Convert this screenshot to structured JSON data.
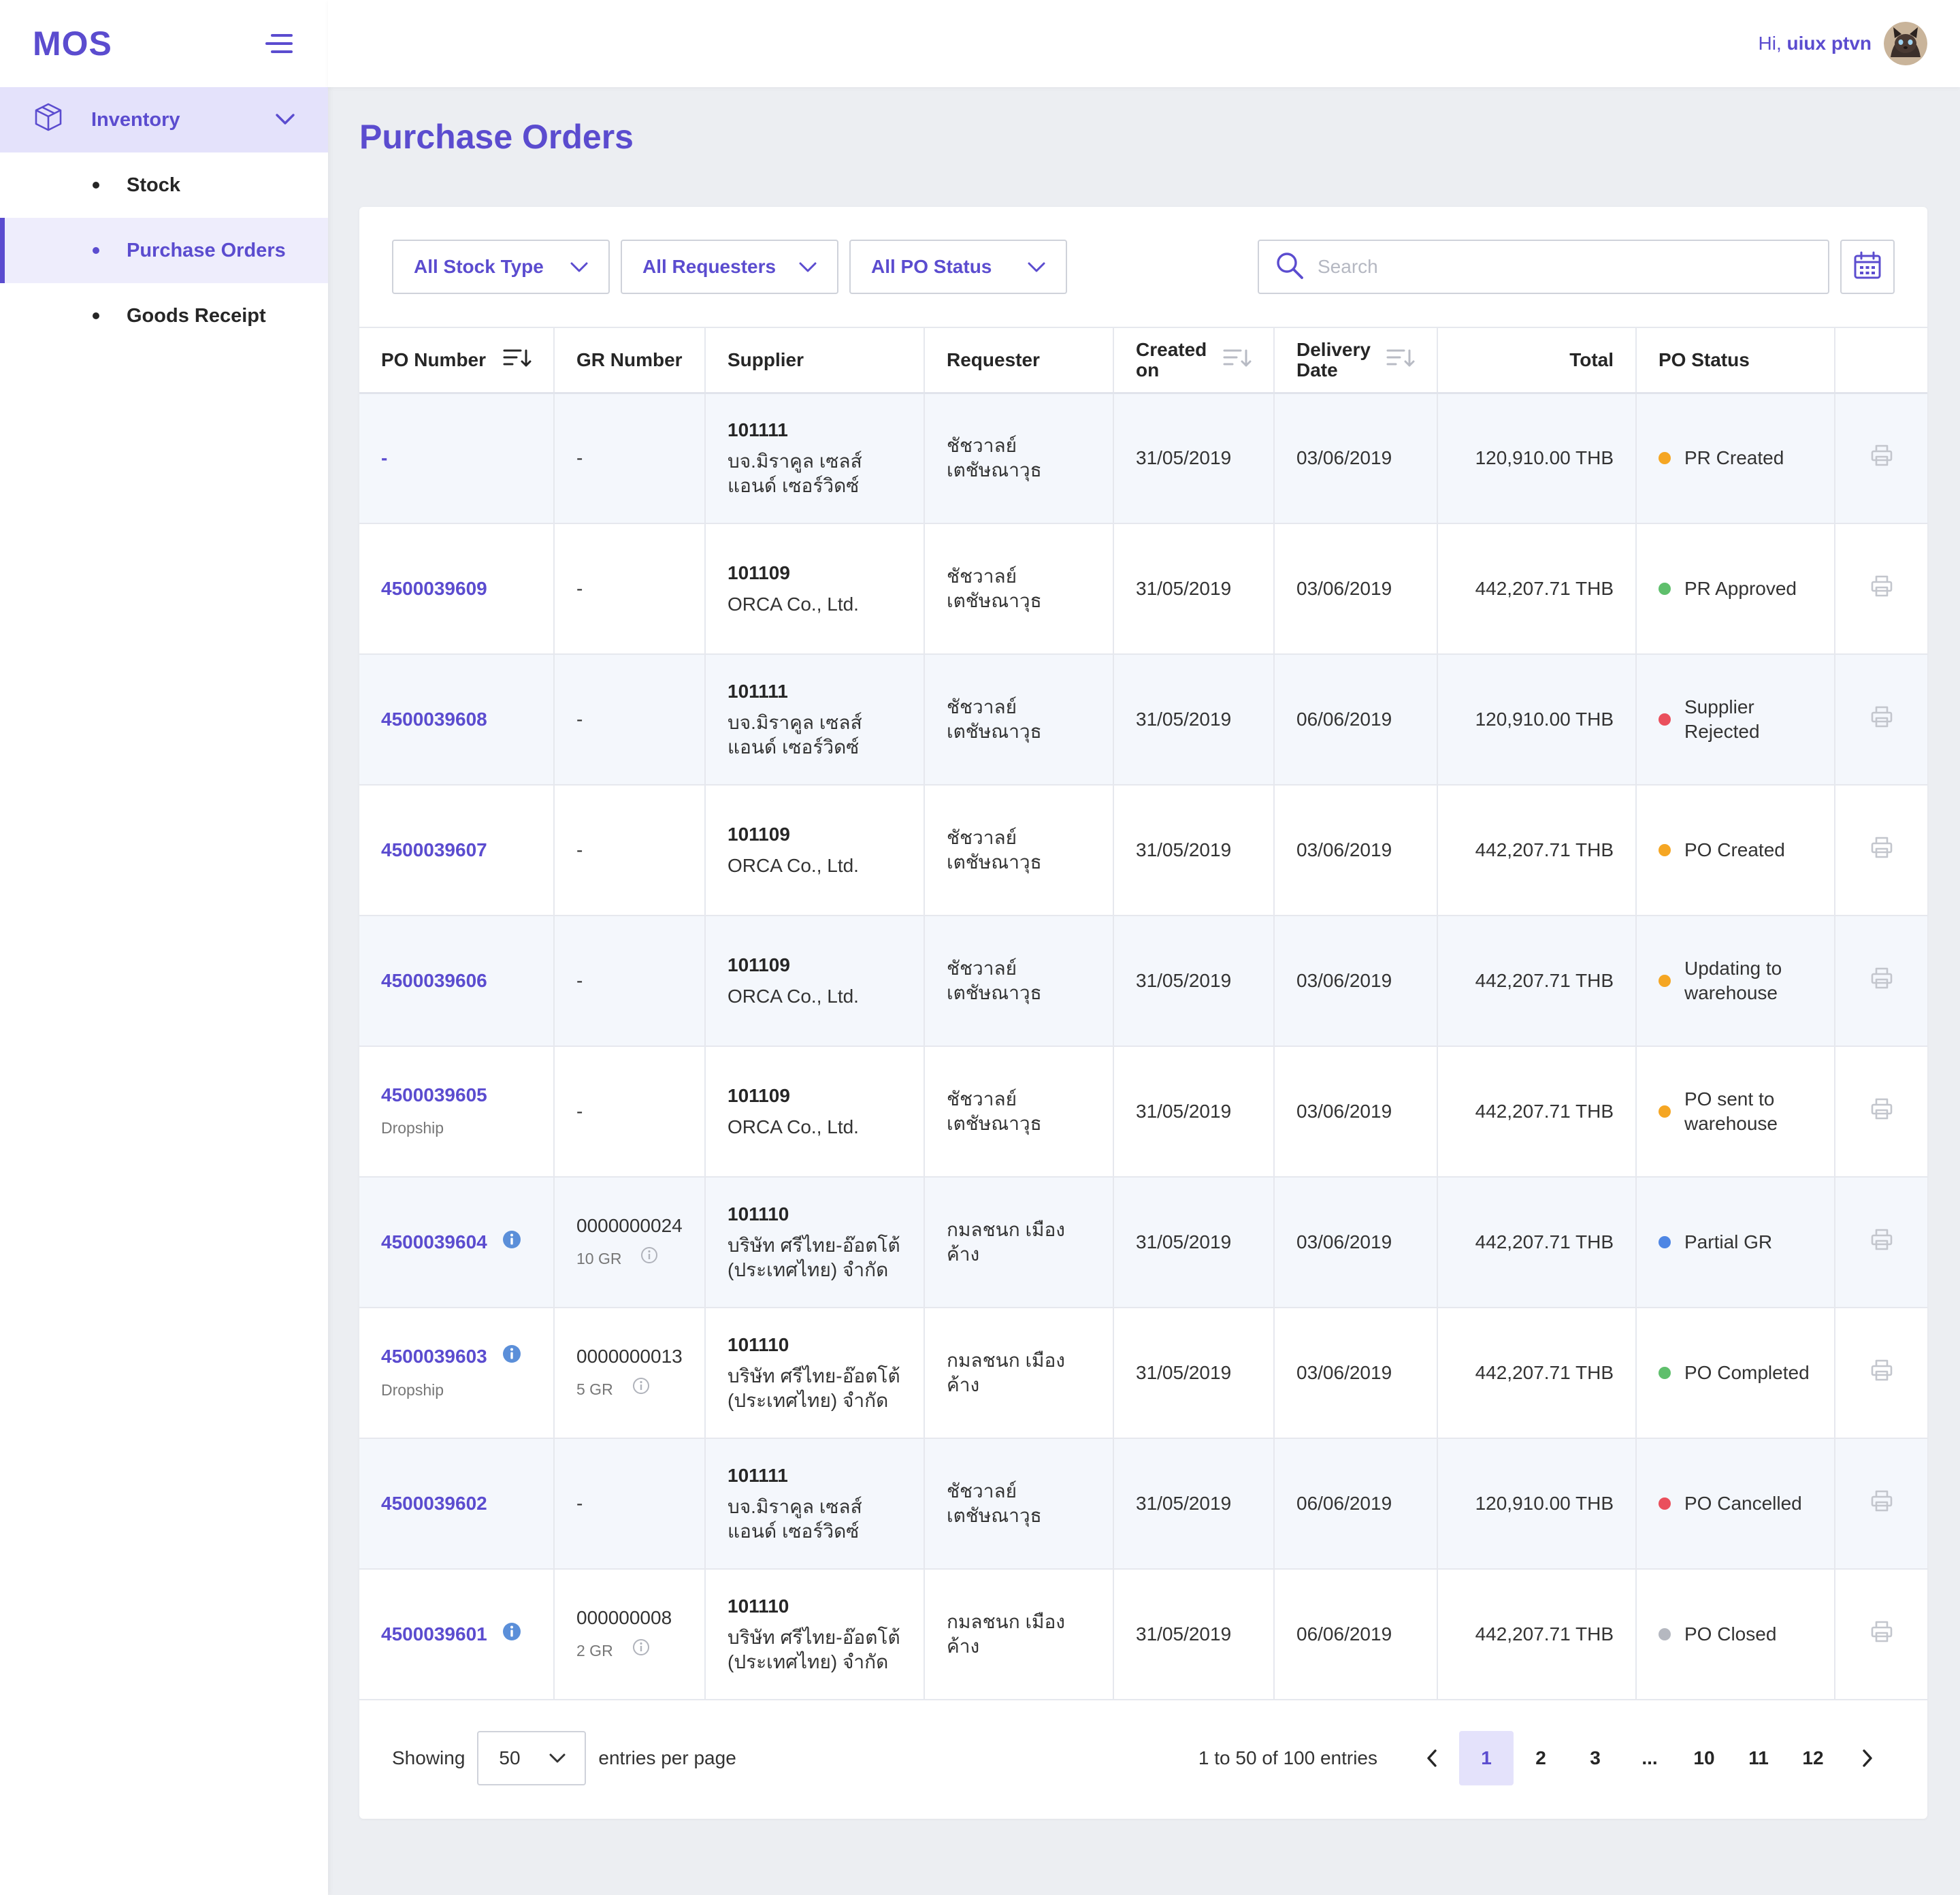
{
  "app": {
    "logo": "MOS"
  },
  "user": {
    "greeting": "Hi,",
    "name": "uiux ptvn"
  },
  "sidebar": {
    "group_label": "Inventory",
    "items": [
      {
        "label": "Stock"
      },
      {
        "label": "Purchase Orders"
      },
      {
        "label": "Goods Receipt"
      }
    ]
  },
  "page": {
    "title": "Purchase Orders"
  },
  "filters": {
    "stock_type": "All Stock Type",
    "requesters": "All Requesters",
    "po_status": "All PO Status",
    "search_placeholder": "Search"
  },
  "table": {
    "headers": {
      "po_number": "PO Number",
      "gr_number": "GR Number",
      "supplier": "Supplier",
      "requester": "Requester",
      "created_on_1": "Created",
      "created_on_2": "on",
      "delivery_1": "Delivery",
      "delivery_2": "Date",
      "total": "Total",
      "po_status": "PO Status"
    },
    "rows": [
      {
        "po": "-",
        "po_sub": "",
        "po_info": false,
        "gr": "-",
        "gr_sub": "",
        "sup_code": "101111",
        "sup_name_1": "บจ.มิราคูล เซลส์",
        "sup_name_2": "แอนด์ เซอร์วิดซ์",
        "req_1": "ชัชวาลย์",
        "req_2": "เตชัษณาวุธ",
        "created": "31/05/2019",
        "delivery": "03/06/2019",
        "total": "120,910.00 THB",
        "status_1": "PR Created",
        "status_2": "",
        "status_color": "#f5a623"
      },
      {
        "po": "4500039609",
        "po_sub": "",
        "po_info": false,
        "gr": "-",
        "gr_sub": "",
        "sup_code": "101109",
        "sup_name_1": "ORCA Co., Ltd.",
        "sup_name_2": "",
        "req_1": "ชัชวาลย์",
        "req_2": "เตชัษณาวุธ",
        "created": "31/05/2019",
        "delivery": "03/06/2019",
        "total": "442,207.71 THB",
        "status_1": "PR Approved",
        "status_2": "",
        "status_color": "#5fbf6c"
      },
      {
        "po": "4500039608",
        "po_sub": "",
        "po_info": false,
        "gr": "-",
        "gr_sub": "",
        "sup_code": "101111",
        "sup_name_1": "บจ.มิราคูล เซลส์",
        "sup_name_2": "แอนด์ เซอร์วิดซ์",
        "req_1": "ชัชวาลย์",
        "req_2": "เตชัษณาวุธ",
        "created": "31/05/2019",
        "delivery": "06/06/2019",
        "total": "120,910.00 THB",
        "status_1": "Supplier",
        "status_2": "Rejected",
        "status_color": "#ea4f5c"
      },
      {
        "po": "4500039607",
        "po_sub": "",
        "po_info": false,
        "gr": "-",
        "gr_sub": "",
        "sup_code": "101109",
        "sup_name_1": "ORCA Co., Ltd.",
        "sup_name_2": "",
        "req_1": "ชัชวาลย์",
        "req_2": "เตชัษณาวุธ",
        "created": "31/05/2019",
        "delivery": "03/06/2019",
        "total": "442,207.71 THB",
        "status_1": "PO Created",
        "status_2": "",
        "status_color": "#f5a623"
      },
      {
        "po": "4500039606",
        "po_sub": "",
        "po_info": false,
        "gr": "-",
        "gr_sub": "",
        "sup_code": "101109",
        "sup_name_1": "ORCA Co., Ltd.",
        "sup_name_2": "",
        "req_1": "ชัชวาลย์",
        "req_2": "เตชัษณาวุธ",
        "created": "31/05/2019",
        "delivery": "03/06/2019",
        "total": "442,207.71 THB",
        "status_1": "Updating to",
        "status_2": "warehouse",
        "status_color": "#f5a623"
      },
      {
        "po": "4500039605",
        "po_sub": "Dropship",
        "po_info": false,
        "gr": "-",
        "gr_sub": "",
        "sup_code": "101109",
        "sup_name_1": "ORCA Co., Ltd.",
        "sup_name_2": "",
        "req_1": "ชัชวาลย์",
        "req_2": "เตชัษณาวุธ",
        "created": "31/05/2019",
        "delivery": "03/06/2019",
        "total": "442,207.71 THB",
        "status_1": "PO sent to",
        "status_2": "warehouse",
        "status_color": "#f5a623"
      },
      {
        "po": "4500039604",
        "po_sub": "",
        "po_info": true,
        "gr": "0000000024",
        "gr_sub": "10 GR",
        "sup_code": "101110",
        "sup_name_1": "บริษัท ศรีไทย-อ๊อตโต้",
        "sup_name_2": "(ประเทศไทย) จำกัด",
        "req_1": "กมลชนก เมืองค้าง",
        "req_2": "",
        "created": "31/05/2019",
        "delivery": "03/06/2019",
        "total": "442,207.71 THB",
        "status_1": "Partial GR",
        "status_2": "",
        "status_color": "#4e86e4"
      },
      {
        "po": "4500039603",
        "po_sub": "Dropship",
        "po_info": true,
        "gr": "0000000013",
        "gr_sub": "5 GR",
        "sup_code": "101110",
        "sup_name_1": "บริษัท ศรีไทย-อ๊อตโต้",
        "sup_name_2": "(ประเทศไทย) จำกัด",
        "req_1": "กมลชนก เมืองค้าง",
        "req_2": "",
        "created": "31/05/2019",
        "delivery": "03/06/2019",
        "total": "442,207.71 THB",
        "status_1": "PO Completed",
        "status_2": "",
        "status_color": "#5fbf6c"
      },
      {
        "po": "4500039602",
        "po_sub": "",
        "po_info": false,
        "gr": "-",
        "gr_sub": "",
        "sup_code": "101111",
        "sup_name_1": "บจ.มิราคูล เซลส์",
        "sup_name_2": "แอนด์ เซอร์วิดซ์",
        "req_1": "ชัชวาลย์",
        "req_2": "เตชัษณาวุธ",
        "created": "31/05/2019",
        "delivery": "06/06/2019",
        "total": "120,910.00 THB",
        "status_1": "PO Cancelled",
        "status_2": "",
        "status_color": "#ea4f5c"
      },
      {
        "po": "4500039601",
        "po_sub": "",
        "po_info": true,
        "gr": "000000008",
        "gr_sub": "2 GR",
        "sup_code": "101110",
        "sup_name_1": "บริษัท ศรีไทย-อ๊อตโต้",
        "sup_name_2": "(ประเทศไทย) จำกัด",
        "req_1": "กมลชนก เมืองค้าง",
        "req_2": "",
        "created": "31/05/2019",
        "delivery": "06/06/2019",
        "total": "442,207.71 THB",
        "status_1": "PO Closed",
        "status_2": "",
        "status_color": "#b5b8c0"
      }
    ]
  },
  "footer": {
    "showing": "Showing",
    "per_page_value": "50",
    "per_page_suffix": "entries per page",
    "range": "1 to 50 of 100 entries",
    "pages": [
      "1",
      "2",
      "3",
      "...",
      "10",
      "11",
      "12"
    ]
  },
  "colors": {
    "accent": "#5b4ccf",
    "accent_light": "#e4e2fb",
    "row_alt": "#f4f7fc"
  }
}
